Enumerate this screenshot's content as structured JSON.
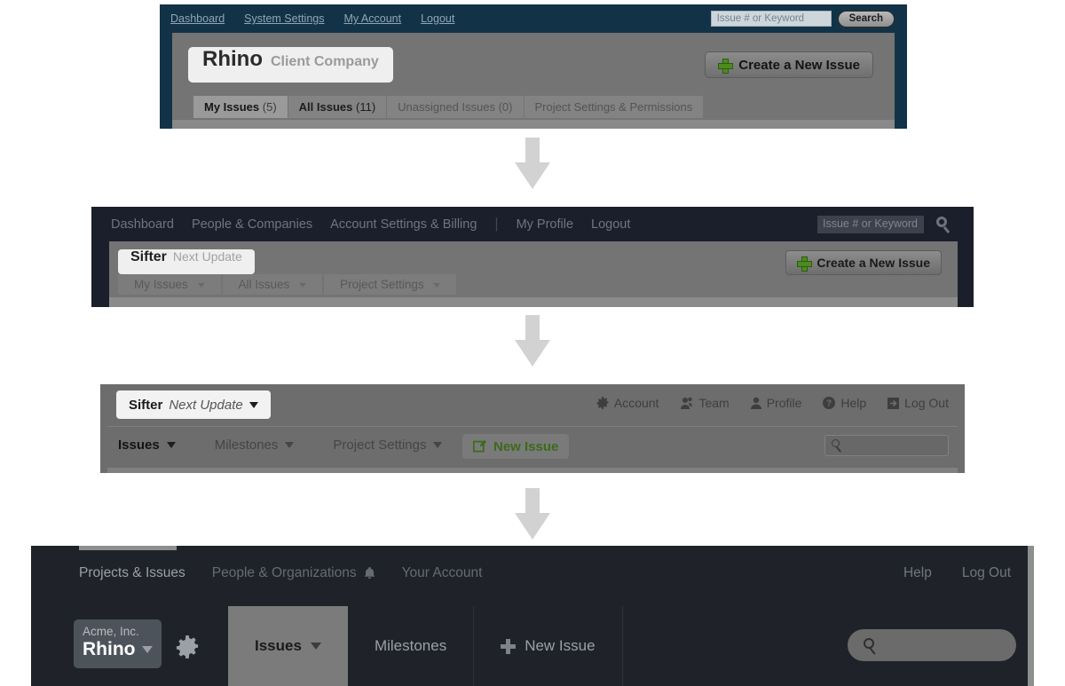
{
  "page": {
    "title": "Sifter navigation evolution"
  },
  "panel1": {
    "topnav": [
      "Dashboard",
      "System Settings",
      "My Account",
      "Logout"
    ],
    "search": {
      "placeholder": "Issue # or Keyword",
      "button_label": "Search"
    },
    "brand": {
      "name": "Rhino",
      "subtitle": "Client Company"
    },
    "create_button": {
      "label": "Create a New Issue",
      "icon": "plus-icon"
    },
    "tabs": [
      {
        "label": "My Issues",
        "count": "(5)",
        "state": "active"
      },
      {
        "label": "All Issues",
        "count": "(11)",
        "state": "bold"
      },
      {
        "label": "Unassigned Issues (0)",
        "count": "",
        "state": "normal"
      },
      {
        "label": "Project Settings & Permissions",
        "count": "",
        "state": "normal"
      }
    ],
    "colors": {
      "header_bg": "#123347",
      "body_bg": "#747474",
      "plus_green": "#4b8c1e"
    }
  },
  "panel2": {
    "topnav": [
      "Dashboard",
      "People & Companies",
      "Account Settings & Billing"
    ],
    "topnav_right": [
      "My Profile",
      "Logout"
    ],
    "divider": "|",
    "search": {
      "placeholder": "Issue # or Keyword",
      "icon": "search-icon"
    },
    "brand": {
      "name": "Sifter",
      "subtitle": "Next Update"
    },
    "create_button": {
      "label": "Create a New Issue",
      "icon": "plus-icon"
    },
    "menu": [
      "My Issues",
      "All Issues",
      "Project Settings"
    ],
    "colors": {
      "header_bg": "#1b1f2b",
      "body_bg": "#747474"
    }
  },
  "panel3": {
    "brand": {
      "name": "Sifter",
      "subtitle": "Next Update"
    },
    "account_links": [
      {
        "label": "Account",
        "icon": "gear-icon"
      },
      {
        "label": "Team",
        "icon": "team-icon"
      },
      {
        "label": "Profile",
        "icon": "person-icon"
      },
      {
        "label": "Help",
        "icon": "help-icon"
      },
      {
        "label": "Log Out",
        "icon": "logout-icon"
      }
    ],
    "menu": [
      {
        "label": "Issues",
        "state": "active"
      },
      {
        "label": "Milestones",
        "state": "normal"
      },
      {
        "label": "Project Settings",
        "state": "normal"
      }
    ],
    "new_issue": {
      "label": "New Issue",
      "icon": "edit-icon",
      "color": "#3b6b1b"
    },
    "search": {
      "placeholder": "",
      "icon": "search-icon"
    },
    "colors": {
      "bg": "#6d6d6d"
    }
  },
  "panel4": {
    "topnav": [
      {
        "label": "Projects & Issues",
        "icon": ""
      },
      {
        "label": "People & Organizations",
        "icon": "bell-icon"
      },
      {
        "label": "Your Account",
        "icon": ""
      }
    ],
    "topnav_right": [
      {
        "label": "Help"
      },
      {
        "label": "Log Out"
      }
    ],
    "org_chip": {
      "org": "Acme, Inc.",
      "project": "Rhino"
    },
    "settings_icon": "gear-icon",
    "tabs": [
      {
        "label": "Issues",
        "state": "selected",
        "caret": true
      },
      {
        "label": "Milestones",
        "state": "normal",
        "caret": false
      },
      {
        "label": "New Issue",
        "state": "normal",
        "caret": false,
        "icon": "plus-icon"
      }
    ],
    "search": {
      "placeholder": "",
      "icon": "search-icon"
    },
    "colors": {
      "bg": "#1f2329",
      "tab_selected_bg": "#7b7b7b",
      "chip_bg": "#4d535b"
    }
  },
  "arrows": {
    "glyph": "down-arrow",
    "color": "#d2d2d2",
    "count": 3
  }
}
